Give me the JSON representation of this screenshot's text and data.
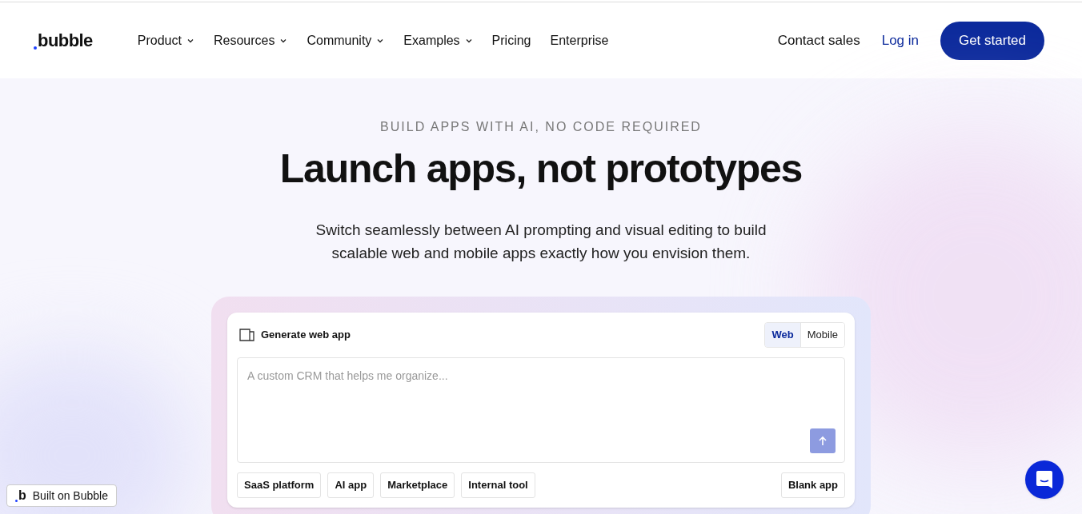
{
  "header": {
    "logo": "bubble",
    "nav": [
      {
        "label": "Product",
        "dropdown": true
      },
      {
        "label": "Resources",
        "dropdown": true
      },
      {
        "label": "Community",
        "dropdown": true
      },
      {
        "label": "Examples",
        "dropdown": true
      },
      {
        "label": "Pricing",
        "dropdown": false
      },
      {
        "label": "Enterprise",
        "dropdown": false
      }
    ],
    "contact": "Contact sales",
    "login": "Log in",
    "cta": "Get started"
  },
  "hero": {
    "eyebrow": "BUILD APPS WITH AI, NO CODE REQUIRED",
    "title": "Launch apps, not prototypes",
    "subtitle": "Switch seamlessly between AI prompting and visual editing to build scalable web and mobile apps exactly how you envision them."
  },
  "generator": {
    "label": "Generate web app",
    "platforms": [
      {
        "label": "Web",
        "selected": true
      },
      {
        "label": "Mobile",
        "selected": false
      }
    ],
    "prompt": {
      "placeholder": "A custom CRM that helps me organize..."
    },
    "templates": [
      "SaaS platform",
      "AI app",
      "Marketplace",
      "Internal tool"
    ],
    "blank": "Blank app"
  },
  "badge": {
    "logo": "b",
    "label": "Built on Bubble"
  }
}
